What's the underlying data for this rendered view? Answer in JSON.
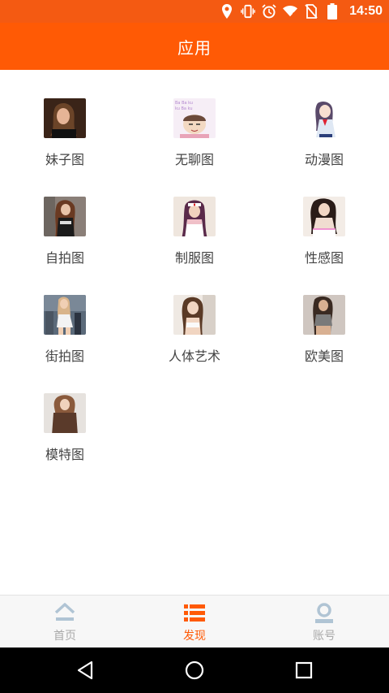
{
  "status_bar": {
    "time": "14:50",
    "icons": [
      "location-icon",
      "vibrate-icon",
      "alarm-icon",
      "wifi-icon",
      "no-sim-icon",
      "battery-icon"
    ]
  },
  "header": {
    "title": "应用"
  },
  "apps": [
    {
      "label": "妹子图"
    },
    {
      "label": "无聊图"
    },
    {
      "label": "动漫图"
    },
    {
      "label": "自拍图"
    },
    {
      "label": "制服图"
    },
    {
      "label": "性感图"
    },
    {
      "label": "街拍图"
    },
    {
      "label": "人体艺术"
    },
    {
      "label": "欧美图"
    },
    {
      "label": "模特图"
    }
  ],
  "tabbar": {
    "tabs": [
      {
        "label": "首页",
        "icon": "home-icon"
      },
      {
        "label": "发现",
        "icon": "list-icon",
        "active": true
      },
      {
        "label": "账号",
        "icon": "user-icon"
      }
    ]
  },
  "nav": {
    "icons": [
      "back-icon",
      "home-circle-icon",
      "recents-icon"
    ]
  },
  "colors": {
    "accent": "#ff5a05",
    "inactive": "#a9a9a9"
  }
}
